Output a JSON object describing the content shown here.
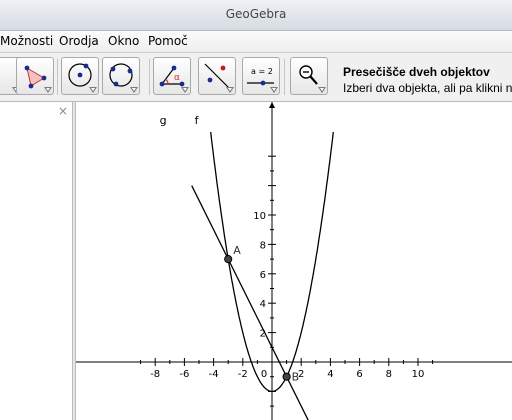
{
  "window": {
    "title": "GeoGebra"
  },
  "menu": {
    "items": [
      "Možnosti",
      "Orodja",
      "Okno",
      "Pomoč"
    ]
  },
  "toolbar": {
    "tools": [
      {
        "name": "polygon-tool",
        "icon": "polygon-icon"
      },
      {
        "name": "circle-center-point-tool",
        "icon": "circle-center-icon"
      },
      {
        "name": "circle-three-points-tool",
        "icon": "circle-three-points-icon"
      },
      {
        "name": "angle-tool",
        "icon": "angle-icon",
        "label": "α"
      },
      {
        "name": "reflect-line-tool",
        "icon": "reflect-icon"
      },
      {
        "name": "slider-tool",
        "icon": "slider-icon",
        "label": "a = 2"
      },
      {
        "name": "zoom-out-tool",
        "icon": "zoom-out-icon"
      }
    ],
    "help_title": "Presečišče dveh objektov",
    "help_text": "Izberi dva objekta, ali pa klikni n"
  },
  "algebra_view": {
    "close": "×"
  },
  "graphics": {
    "x_ticks": [
      "-8",
      "-6",
      "-4",
      "-2",
      "0",
      "2",
      "4",
      "6",
      "8",
      "10"
    ],
    "y_ticks": [
      "10",
      "8",
      "6",
      "4",
      "2"
    ],
    "curve_labels": {
      "g": "g",
      "f": "f"
    },
    "points": [
      {
        "label": "A",
        "x": -3,
        "y": 7
      },
      {
        "label": "B",
        "x": 1,
        "y": -1
      }
    ],
    "functions": {
      "f": {
        "formula": "x^2 - 2",
        "color": "#000000"
      },
      "g": {
        "formula": "-2x + 1",
        "color": "#000000"
      }
    }
  }
}
